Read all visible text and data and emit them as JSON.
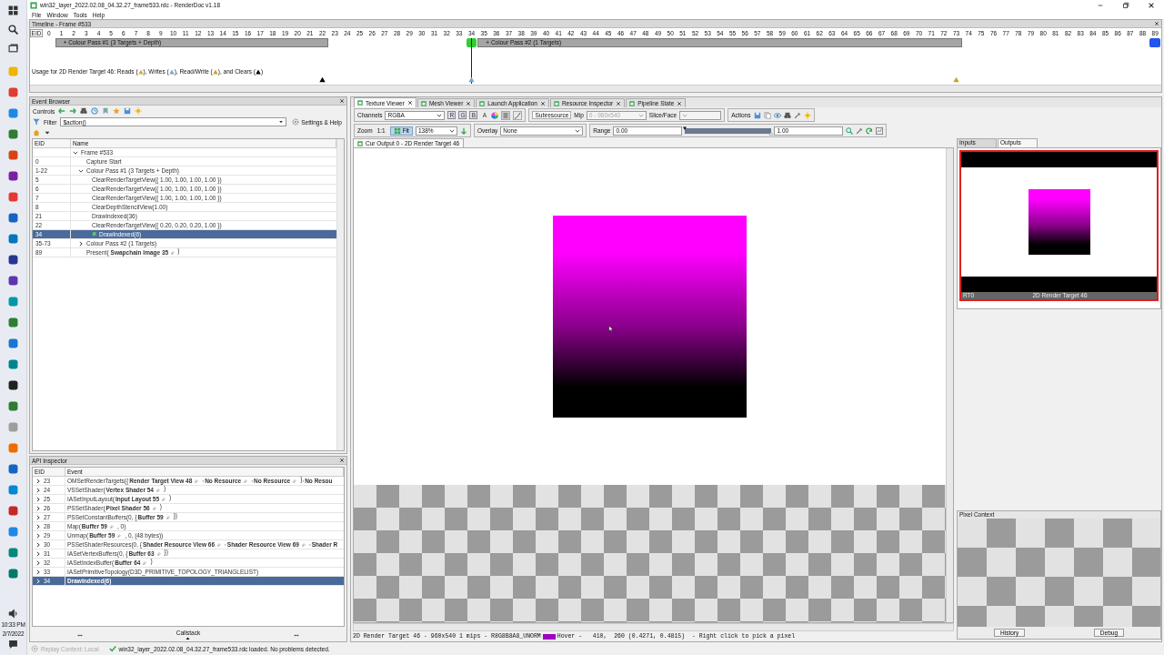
{
  "window": {
    "title": "win32_layer_2022.02.08_04.32.27_frame533.rdc - RenderDoc v1.18"
  },
  "menu": [
    "File",
    "Window",
    "Tools",
    "Help"
  ],
  "timeline": {
    "title": "Timeline - Frame #533",
    "eid_label": "EID",
    "segments": [
      {
        "ticks": [
          "0"
        ]
      },
      {
        "label": "+ Colour Pass #1 (3 Targets + Depth)",
        "ticks": [
          "1",
          "2",
          "3",
          "4",
          "5",
          "6",
          "7",
          "8",
          "9",
          "10",
          "11",
          "12",
          "13",
          "14",
          "15",
          "16",
          "17",
          "18",
          "19",
          "20",
          "21",
          {
            "label": "22",
            "marker": {
              "color": "#000000"
            }
          }
        ]
      },
      {
        "ticks": [
          "23",
          "24",
          "25",
          "26",
          "27",
          "28",
          "29",
          "30",
          "31",
          "32",
          "33",
          {
            "label": "34",
            "current": true,
            "block": {
              "color": "#33cc33"
            },
            "marker": {
              "color": "#6fa8d6"
            }
          }
        ]
      },
      {
        "label": "+ Colour Pass #2 (1 Targets)",
        "ticks": [
          "35",
          "36",
          "37",
          "38",
          "39",
          "40",
          "41",
          "42",
          "43",
          "44",
          "45",
          "46",
          "47",
          "48",
          "49",
          "50",
          "51",
          "52",
          "53",
          "54",
          "55",
          "56",
          "57",
          "58",
          "59",
          "60",
          "61",
          "62",
          "63",
          "64",
          "65",
          "66",
          "67",
          "68",
          "69",
          "70",
          "71",
          "72",
          {
            "label": "73",
            "marker": {
              "color": "#c9a227"
            }
          }
        ]
      },
      {
        "ticks": [
          "74",
          "75",
          "76",
          "77",
          "78",
          "79",
          "80",
          "81",
          "82",
          "83",
          "84",
          "85",
          "86",
          "87",
          "88",
          {
            "label": "89",
            "block": {
              "color": "#2255ee"
            }
          }
        ]
      }
    ],
    "usage": [
      {
        "kind": "text",
        "text": "Usage for 2D Render Target 46: Reads ("
      },
      {
        "kind": "marker",
        "color": "#c8b040"
      },
      {
        "kind": "text",
        "text": "), Writes ("
      },
      {
        "kind": "marker",
        "color": "#6fa8d6"
      },
      {
        "kind": "text",
        "text": "), Read/Write ("
      },
      {
        "kind": "marker",
        "color": "#c9a227"
      },
      {
        "kind": "text",
        "text": "), and Clears ("
      },
      {
        "kind": "marker",
        "color": "#000000"
      },
      {
        "kind": "text",
        "text": ")"
      }
    ]
  },
  "event_browser": {
    "title": "Event Browser",
    "controls_label": "Controls",
    "filter_label": "Filter",
    "filter_value": "$action()",
    "settings_label": "Settings & Help",
    "columns": [
      "EID",
      "Name"
    ],
    "events": [
      {
        "parts": [
          {
            "kind": "text",
            "text": "Frame #533"
          }
        ],
        "expanded": true,
        "selected": false,
        "children": [
          {
            "eid": "0",
            "parts": [
              {
                "kind": "text",
                "text": "Capture Start"
              }
            ],
            "selected": false
          },
          {
            "eid": "1-22",
            "parts": [
              {
                "kind": "text",
                "text": "Colour Pass #1 (3 Targets + Depth)"
              }
            ],
            "expanded": true,
            "selected": false,
            "children": [
              {
                "eid": "5",
                "parts": [
                  {
                    "kind": "text",
                    "text": "ClearRenderTargetView({ 1.00, 1.00, 1.00, 1.00 })"
                  }
                ],
                "selected": false
              },
              {
                "eid": "6",
                "parts": [
                  {
                    "kind": "text",
                    "text": "ClearRenderTargetView({ 1.00, 1.00, 1.00, 1.00 })"
                  }
                ],
                "selected": false
              },
              {
                "eid": "7",
                "parts": [
                  {
                    "kind": "text",
                    "text": "ClearRenderTargetView({ 1.00, 1.00, 1.00, 1.00 })"
                  }
                ],
                "selected": false
              },
              {
                "eid": "8",
                "parts": [
                  {
                    "kind": "text",
                    "text": "ClearDepthStencilView(1.00)"
                  }
                ],
                "selected": false
              },
              {
                "eid": "21",
                "parts": [
                  {
                    "kind": "text",
                    "text": "DrawIndexed(36)"
                  }
                ],
                "selected": false
              },
              {
                "eid": "22",
                "parts": [
                  {
                    "kind": "text",
                    "text": "ClearRenderTargetView({ 0.20, 0.20, 0.20, 1.00 })"
                  }
                ],
                "selected": false
              },
              {
                "eid": "34",
                "parts": [
                  {
                    "kind": "text",
                    "text": "DrawIndexed(6)"
                  }
                ],
                "selected": true
              }
            ]
          },
          {
            "eid": "35-73",
            "parts": [
              {
                "kind": "text",
                "text": "Colour Pass #2 (1 Targets)"
              }
            ],
            "expanded": false,
            "selected": false
          },
          {
            "eid": "89",
            "parts": [
              {
                "kind": "text",
                "text": "Present("
              },
              {
                "kind": "resource",
                "text": "Swapchain Image 35"
              },
              {
                "kind": "text",
                "text": ")"
              }
            ],
            "selected": false
          }
        ]
      }
    ]
  },
  "api_inspector": {
    "title": "API Inspector",
    "columns": [
      "EID",
      "Event"
    ],
    "calls": [
      {
        "eid": "23",
        "expanded": false,
        "selected": false,
        "parts": [
          {
            "kind": "text",
            "text": "OMSetRenderTargets({"
          },
          {
            "kind": "resource",
            "text": "Render Target View 48"
          },
          {
            "kind": "text",
            "text": ","
          },
          {
            "kind": "resource",
            "text": "No Resource"
          },
          {
            "kind": "text",
            "text": ","
          },
          {
            "kind": "resource",
            "text": "No Resource"
          },
          {
            "kind": "text",
            "text": "},"
          },
          {
            "kind": "bold",
            "text": "No Resou"
          }
        ]
      },
      {
        "eid": "24",
        "expanded": false,
        "selected": false,
        "parts": [
          {
            "kind": "text",
            "text": "VSSetShader("
          },
          {
            "kind": "resource",
            "text": "Vertex Shader 54"
          },
          {
            "kind": "text",
            "text": ")"
          }
        ]
      },
      {
        "eid": "25",
        "expanded": false,
        "selected": false,
        "parts": [
          {
            "kind": "text",
            "text": "IASetInputLayout("
          },
          {
            "kind": "resource",
            "text": "Input Layout 55"
          },
          {
            "kind": "text",
            "text": ")"
          }
        ]
      },
      {
        "eid": "26",
        "expanded": false,
        "selected": false,
        "parts": [
          {
            "kind": "text",
            "text": "PSSetShader("
          },
          {
            "kind": "resource",
            "text": "Pixel Shader 56"
          },
          {
            "kind": "text",
            "text": ")"
          }
        ]
      },
      {
        "eid": "27",
        "expanded": false,
        "selected": false,
        "parts": [
          {
            "kind": "text",
            "text": "PSSetConstantBuffers(0, {"
          },
          {
            "kind": "resource",
            "text": "Buffer 59"
          },
          {
            "kind": "text",
            "text": "})"
          }
        ]
      },
      {
        "eid": "28",
        "expanded": false,
        "selected": false,
        "parts": [
          {
            "kind": "text",
            "text": "Map("
          },
          {
            "kind": "resource",
            "text": "Buffer 59"
          },
          {
            "kind": "text",
            "text": ", 0)"
          }
        ]
      },
      {
        "eid": "29",
        "expanded": false,
        "selected": false,
        "parts": [
          {
            "kind": "text",
            "text": "Unmap("
          },
          {
            "kind": "resource",
            "text": "Buffer 59"
          },
          {
            "kind": "text",
            "text": ", 0, (48 bytes))"
          }
        ]
      },
      {
        "eid": "30",
        "expanded": false,
        "selected": false,
        "parts": [
          {
            "kind": "text",
            "text": "PSSetShaderResources(0, {"
          },
          {
            "kind": "resource",
            "text": "Shader Resource View 66"
          },
          {
            "kind": "text",
            "text": ","
          },
          {
            "kind": "resource",
            "text": "Shader Resource View 69"
          },
          {
            "kind": "text",
            "text": ","
          },
          {
            "kind": "bold",
            "text": "Shader R"
          }
        ]
      },
      {
        "eid": "31",
        "expanded": false,
        "selected": false,
        "parts": [
          {
            "kind": "text",
            "text": "IASetVertexBuffers(0, {"
          },
          {
            "kind": "resource",
            "text": "Buffer 63"
          },
          {
            "kind": "text",
            "text": "})"
          }
        ]
      },
      {
        "eid": "32",
        "expanded": false,
        "selected": false,
        "parts": [
          {
            "kind": "text",
            "text": "IASetIndexBuffer("
          },
          {
            "kind": "resource",
            "text": "Buffer 64"
          },
          {
            "kind": "text",
            "text": ")"
          }
        ]
      },
      {
        "eid": "33",
        "expanded": false,
        "selected": false,
        "parts": [
          {
            "kind": "text",
            "text": "IASetPrimitiveTopology(D3D_PRIMITIVE_TOPOLOGY_TRIANGLELIST)"
          }
        ]
      },
      {
        "eid": "34",
        "expanded": false,
        "selected": true,
        "parts": [
          {
            "kind": "bold",
            "text": "DrawIndexed(6)"
          }
        ]
      }
    ],
    "callstack_label": "Callstack"
  },
  "texture_viewer": {
    "tabs": [
      {
        "label": "Texture Viewer",
        "selected": true
      },
      {
        "label": "Mesh Viewer",
        "selected": false
      },
      {
        "label": "Launch Application",
        "selected": false
      },
      {
        "label": "Resource Inspector",
        "selected": false
      },
      {
        "label": "Pipeline State",
        "selected": false
      }
    ],
    "channels_label": "Channels",
    "channels_value": "RGBA",
    "channel_buttons": [
      {
        "label": "R",
        "on": true
      },
      {
        "label": "G",
        "on": true
      },
      {
        "label": "B",
        "on": true
      },
      {
        "label": "A",
        "on": false
      }
    ],
    "subresource_label": "Subresource",
    "mip_label": "Mip",
    "mip_value": "0 - 960x540",
    "mip_disabled": true,
    "slice_label": "Slice/Face",
    "actions_label": "Actions",
    "zoom_label": "Zoom",
    "zoom_actual": "1:1",
    "fit": {
      "label": "Fit",
      "selected": true
    },
    "zoom_value": "138%",
    "overlay_label": "Overlay",
    "overlay_value": "None",
    "range_label": "Range",
    "range_min": "0.00",
    "range_max": "1.00",
    "range_low": {
      "level": 0
    },
    "range_high": {
      "level": 1
    },
    "output_tab": "Cur Output 0 - 2D Render Target 46",
    "status_info": "2D Render Target 46 - 960x540 1 mips - R8G8B8A8_UNORM",
    "hover_swatch": {
      "color": "#a000c0"
    },
    "status_hover": "Hover -   410,  260 (0.4271, 0.4815)  - Right click to pick a pixel",
    "side_tabs": [
      {
        "label": "Inputs",
        "selected": false
      },
      {
        "label": "Outputs",
        "selected": true
      }
    ],
    "thumbnails": [
      {
        "slot": "RT0",
        "name": "2D Render Target 46",
        "selected": true
      }
    ],
    "pixel_context": {
      "title": "Pixel Context",
      "buttons": [
        "History",
        "Debug"
      ]
    }
  },
  "status_bar": {
    "replay": "Replay Context: Local",
    "message": "win32_layer_2022.02.08_04.32.27_frame533.rdc loaded. No problems detected."
  },
  "taskbar": {
    "time": "10:33 PM",
    "date": "2/7/2022"
  }
}
